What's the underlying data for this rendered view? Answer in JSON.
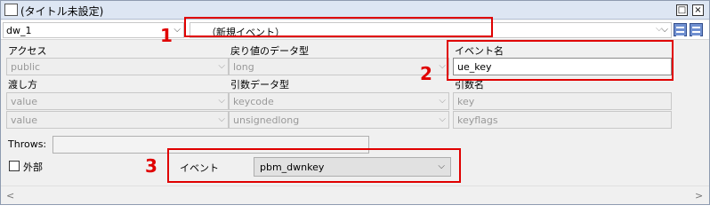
{
  "window": {
    "title": "(タイトル未設定)",
    "buttons": {
      "minimize": "□",
      "close": "×"
    }
  },
  "toolbar": {
    "dw_name": "dw_1",
    "event_combo_value": "（新規イベント）"
  },
  "form": {
    "access_label": "アクセス",
    "return_type_label": "戻り値のデータ型",
    "event_name_label": "イベント名",
    "access_value": "public",
    "return_type_value": "long",
    "event_name_value": "ue_key",
    "pass_by_label": "渡し方",
    "arg_type_label": "引数データ型",
    "arg_name_label": "引数名",
    "args": [
      {
        "pass_by": "value",
        "type": "keycode",
        "name": "key"
      },
      {
        "pass_by": "value",
        "type": "unsignedlong",
        "name": "keyflags"
      }
    ],
    "throws_label": "Throws:",
    "throws_value": "",
    "external_label": "外部",
    "event_label": "イベント",
    "event_value": "pbm_dwnkey"
  },
  "callouts": [
    "1",
    "2",
    "3"
  ],
  "colors": {
    "callout": "#e00000",
    "view_button": "#6f8fd0"
  },
  "icons": [
    "window-icon",
    "chevron-down-icon",
    "view-list-icon",
    "view-detail-icon",
    "scroll-left-icon",
    "scroll-right-icon"
  ]
}
